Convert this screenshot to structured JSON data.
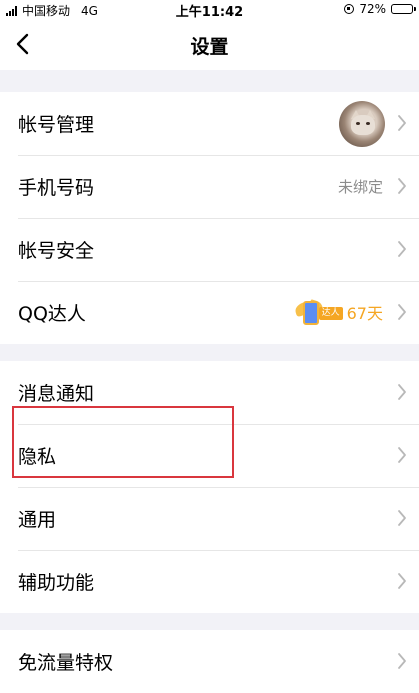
{
  "status_bar": {
    "carrier": "中国移动",
    "network": "4G",
    "time": "上午11:42",
    "battery": "72%",
    "battery_level": 0.72
  },
  "nav": {
    "title": "设置",
    "back_icon": "chevron-left-icon"
  },
  "groups": [
    {
      "items": [
        {
          "label": "帐号管理"
        },
        {
          "label": "手机号码",
          "value": "未绑定"
        },
        {
          "label": "帐号安全"
        },
        {
          "label": "QQ达人",
          "badge_tag": "达人",
          "badge_value": "67天"
        }
      ]
    },
    {
      "items": [
        {
          "label": "消息通知"
        },
        {
          "label": "隐私"
        },
        {
          "label": "通用"
        },
        {
          "label": "辅助功能"
        }
      ]
    },
    {
      "items": [
        {
          "label": "免流量特权"
        }
      ]
    }
  ],
  "colors": {
    "highlight_box": "#d9363e",
    "qq_badge": "#f5a623",
    "secondary_text": "#8c8c8c"
  }
}
